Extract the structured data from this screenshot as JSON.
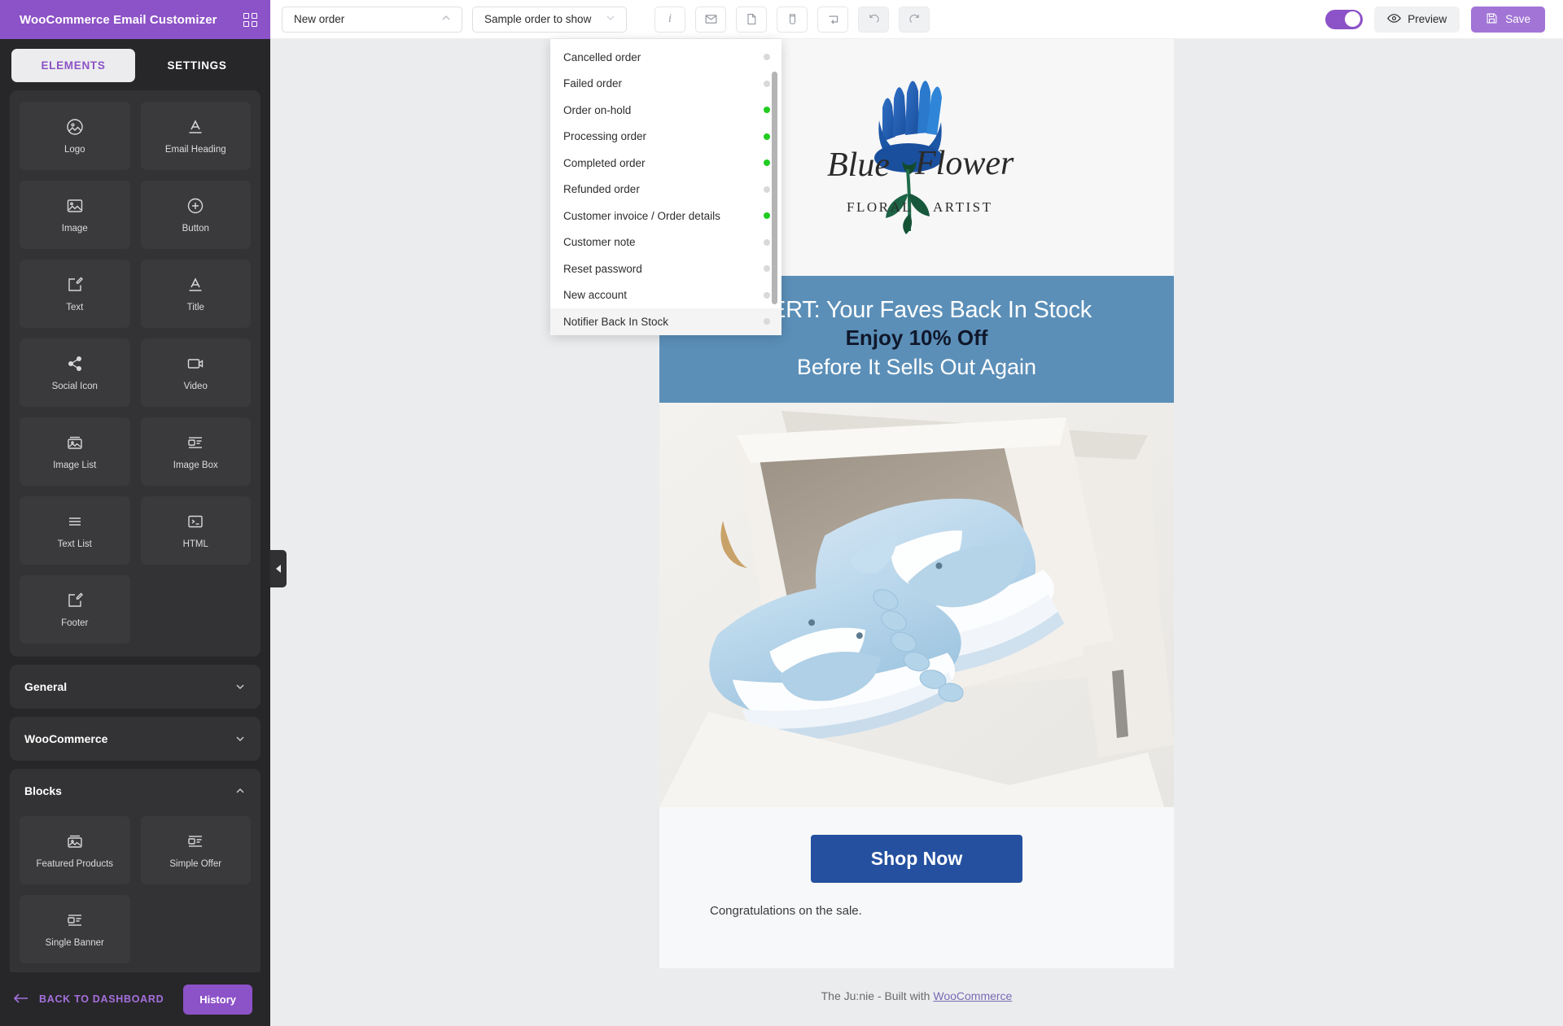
{
  "sidebar": {
    "app_title": "WooCommerce Email Customizer",
    "grid_icon": "grid-icon",
    "tabs": [
      {
        "label": "ELEMENTS",
        "active": true
      },
      {
        "label": "SETTINGS",
        "active": false
      }
    ],
    "elements": [
      {
        "label": "Logo",
        "icon": "logo-icon"
      },
      {
        "label": "Email Heading",
        "icon": "email-heading-icon"
      },
      {
        "label": "Image",
        "icon": "image-icon"
      },
      {
        "label": "Button",
        "icon": "button-icon"
      },
      {
        "label": "Text",
        "icon": "text-icon"
      },
      {
        "label": "Title",
        "icon": "title-icon"
      },
      {
        "label": "Social Icon",
        "icon": "social-icon"
      },
      {
        "label": "Video",
        "icon": "video-icon"
      },
      {
        "label": "Image List",
        "icon": "image-list-icon"
      },
      {
        "label": "Image Box",
        "icon": "image-box-icon"
      },
      {
        "label": "Text List",
        "icon": "text-list-icon"
      },
      {
        "label": "HTML",
        "icon": "html-icon"
      },
      {
        "label": "Footer",
        "icon": "footer-icon"
      }
    ],
    "accordions": [
      {
        "label": "General",
        "expanded": false
      },
      {
        "label": "WooCommerce",
        "expanded": false
      },
      {
        "label": "Blocks",
        "expanded": true
      }
    ],
    "blocks": [
      {
        "label": "Featured Products",
        "icon": "image-list-icon"
      },
      {
        "label": "Simple Offer",
        "icon": "image-box-icon"
      },
      {
        "label": "Single Banner",
        "icon": "image-box-icon"
      }
    ],
    "footer": {
      "back_label": "BACK TO DASHBOARD",
      "back_icon": "arrow-left-icon",
      "history_label": "History"
    }
  },
  "topbar": {
    "email_type_select": {
      "value": "New order",
      "icon": "chevron-up-icon"
    },
    "sample_select": {
      "value": "Sample order to show",
      "icon": "chevron-down-icon"
    },
    "tools": [
      {
        "name": "info-icon",
        "glyph": "i"
      },
      {
        "name": "envelope-icon",
        "glyph": "✉"
      },
      {
        "name": "document-icon",
        "glyph": "🗎"
      },
      {
        "name": "mobile-icon",
        "glyph": "▯"
      },
      {
        "name": "reset-layout-icon",
        "glyph": "⇥"
      },
      {
        "name": "undo-icon",
        "glyph": "↺"
      },
      {
        "name": "redo-icon",
        "glyph": "↻"
      }
    ],
    "toggle": {
      "name": "dark-mode-toggle",
      "on": true
    },
    "preview_label": "Preview",
    "preview_icon": "eye-icon",
    "save_label": "Save",
    "save_icon": "floppy-disk-icon"
  },
  "dropdown": {
    "items": [
      {
        "label": "Cancelled order",
        "status": "off"
      },
      {
        "label": "Failed order",
        "status": "off"
      },
      {
        "label": "Order on-hold",
        "status": "on"
      },
      {
        "label": "Processing order",
        "status": "on"
      },
      {
        "label": "Completed order",
        "status": "on"
      },
      {
        "label": "Refunded order",
        "status": "off"
      },
      {
        "label": "Customer invoice / Order details",
        "status": "on"
      },
      {
        "label": "Customer note",
        "status": "off"
      },
      {
        "label": "Reset password",
        "status": "off"
      },
      {
        "label": "New account",
        "status": "off"
      },
      {
        "label": "Notifier Back In Stock",
        "status": "off"
      }
    ]
  },
  "email": {
    "logo": {
      "name": "Blue Flower",
      "tagline_left": "FLORAL",
      "tagline_right": "ARTIST"
    },
    "banner": {
      "line1": "ALERT: Your Faves Back In Stock",
      "line2": "Enjoy 10% Off",
      "line3": "Before It Sells Out Again",
      "bg_color": "#5b8fb8"
    },
    "hero_alt": "Light blue and white sneakers in an open shoe box",
    "cta_label": "Shop Now",
    "cta_color": "#24509f",
    "body_text": "Congratulations on the sale.",
    "footer_prefix": "The Ju:nie - Built with ",
    "footer_link": "WooCommerce"
  },
  "colors": {
    "brand_purple": "#8c52c7",
    "sidebar_bg": "#272729",
    "canvas_bg": "#ebecee",
    "status_on": "#22cc22",
    "status_off": "#d9d9d9"
  }
}
